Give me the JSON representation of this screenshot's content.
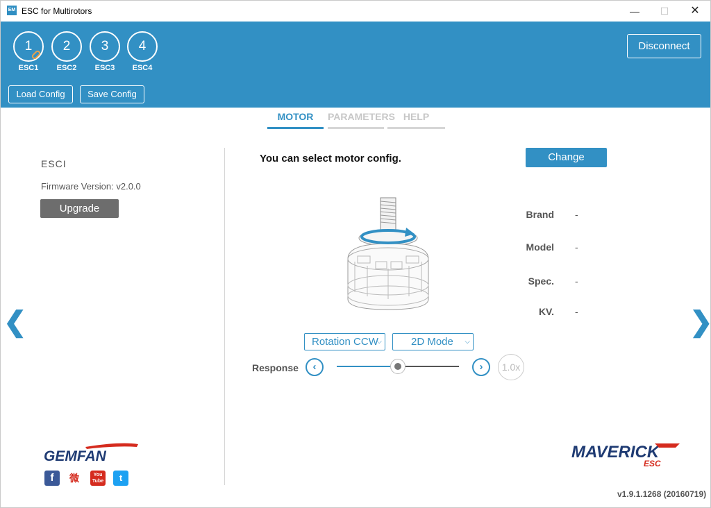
{
  "window": {
    "title": "ESC for Multirotors",
    "app_icon": "EM",
    "min": "—",
    "max": "☐",
    "close": "✕"
  },
  "header": {
    "escs": [
      {
        "number": "1",
        "label": "ESC1",
        "linked": true
      },
      {
        "number": "2",
        "label": "ESC2"
      },
      {
        "number": "3",
        "label": "ESC3"
      },
      {
        "number": "4",
        "label": "ESC4"
      }
    ],
    "load_config": "Load Config",
    "save_config": "Save Config",
    "disconnect": "Disconnect"
  },
  "tabs": [
    {
      "label": "MOTOR",
      "active": true
    },
    {
      "label": "PARAMETERS",
      "active": false
    },
    {
      "label": "HELP",
      "active": false
    }
  ],
  "left": {
    "esc_name": "ESCI",
    "firmware": "Firmware Version: v2.0.0",
    "upgrade": "Upgrade"
  },
  "nav": {
    "prev": "❮",
    "next": "❯"
  },
  "main": {
    "select_text": "You can select motor config.",
    "change": "Change",
    "specs": [
      {
        "label": "Brand",
        "value": "-"
      },
      {
        "label": "Model",
        "value": "-"
      },
      {
        "label": "Spec.",
        "value": "-"
      },
      {
        "label": "KV.",
        "value": "-"
      }
    ],
    "rotation": "Rotation CCW",
    "mode": "2D Mode",
    "response_label": "Response",
    "response_dec": "‹",
    "response_inc": "›",
    "response_level": 0.5,
    "multiplier": "1.0x"
  },
  "brand": {
    "gemfan": "GEMFAN",
    "maverick": "MAVERICK",
    "maverick_sub": "ESC",
    "social": {
      "facebook": "f",
      "weibo": "微",
      "youtube_top": "You",
      "youtube_bottom": "Tube",
      "twitter": "t"
    }
  },
  "version": "v1.9.1.1268 (20160719)",
  "colors": {
    "accent": "#3290c4",
    "upgrade_bg": "#6d6d6d",
    "link_orange": "#e8a24a",
    "gemfan_red": "#d52b1e",
    "maverick_navy": "#1f3b73"
  }
}
